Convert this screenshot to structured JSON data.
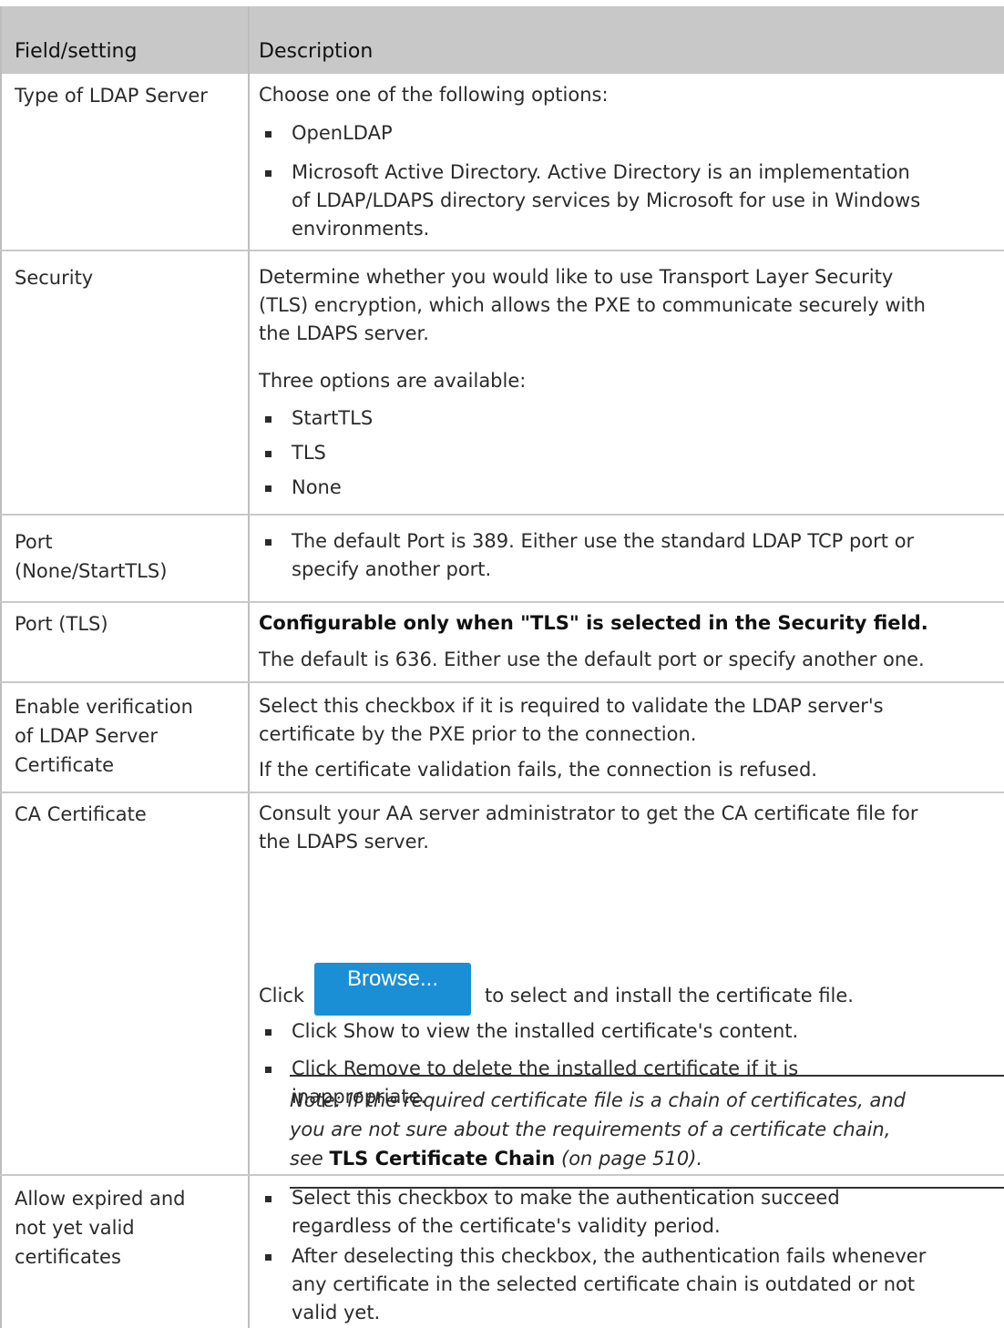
{
  "table": {
    "headers": [
      "Field/setting",
      "Description"
    ],
    "rows": [
      {
        "field_lines": [
          "Type of LDAP Server"
        ],
        "intro": "Choose one of the following options:",
        "bullets": [
          [
            "OpenLDAP"
          ],
          [
            "Microsoft Active Directory. Active Directory is an implementation",
            "of LDAP/LDAPS directory services by Microsoft for use in Windows",
            "environments."
          ]
        ]
      },
      {
        "field_lines": [
          "Security"
        ],
        "desc_lines": [
          "Determine whether you would like to use Transport Layer Security",
          "(TLS) encryption, which allows the PXE to communicate securely with",
          "the LDAPS server."
        ],
        "options_intro": "Three options are available:",
        "bullets": [
          [
            "StartTLS"
          ],
          [
            "TLS"
          ],
          [
            "None"
          ]
        ]
      },
      {
        "field_lines": [
          "Port",
          "(None/StartTLS)"
        ],
        "bullets": [
          [
            "The default Port is 389. Either use the standard LDAP TCP port or",
            "specify another port."
          ]
        ]
      },
      {
        "field_lines": [
          "Port (TLS)"
        ],
        "bold_line": "Configurable only when \"TLS\" is selected in the Security field.",
        "desc": "The default is 636. Either use the default port or specify another one."
      },
      {
        "field_lines": [
          "Enable verification",
          "of LDAP Server",
          "Certificate"
        ],
        "desc_lines": [
          "Select this checkbox if it is required to validate the LDAP server's",
          "certificate by the PXE prior to the connection."
        ],
        "desc2": "If the certificate validation fails, the connection is refused."
      },
      {
        "field_lines": [
          "CA Certificate"
        ],
        "desc_lines": [
          "Consult your AA server administrator to get the CA certificate file for",
          "the LDAPS server."
        ],
        "click_prefix": "Click",
        "browse_label": "Browse...",
        "click_suffix": "to select and install the certificate file.",
        "bullets": [
          [
            "Click Show to view the installed certificate's content."
          ],
          [
            "Click Remove to delete the installed certificate if it is",
            "inappropriate."
          ]
        ],
        "note": {
          "line1": "Note: If the required certificate file is a chain of certificates, and",
          "line2": "you are not sure about the requirements of a certificate chain,",
          "see": "see",
          "link": "TLS Certificate Chain",
          "page_ref": "(on page 510)."
        }
      },
      {
        "field_lines": [
          "Allow expired and",
          "not yet valid",
          "certificates"
        ],
        "bullets": [
          [
            "Select this checkbox to make the authentication succeed",
            "regardless of the certificate's validity period."
          ],
          [
            "After deselecting this checkbox, the authentication fails whenever",
            "any certificate in the selected certificate chain is outdated or not",
            "valid yet."
          ]
        ]
      }
    ]
  }
}
